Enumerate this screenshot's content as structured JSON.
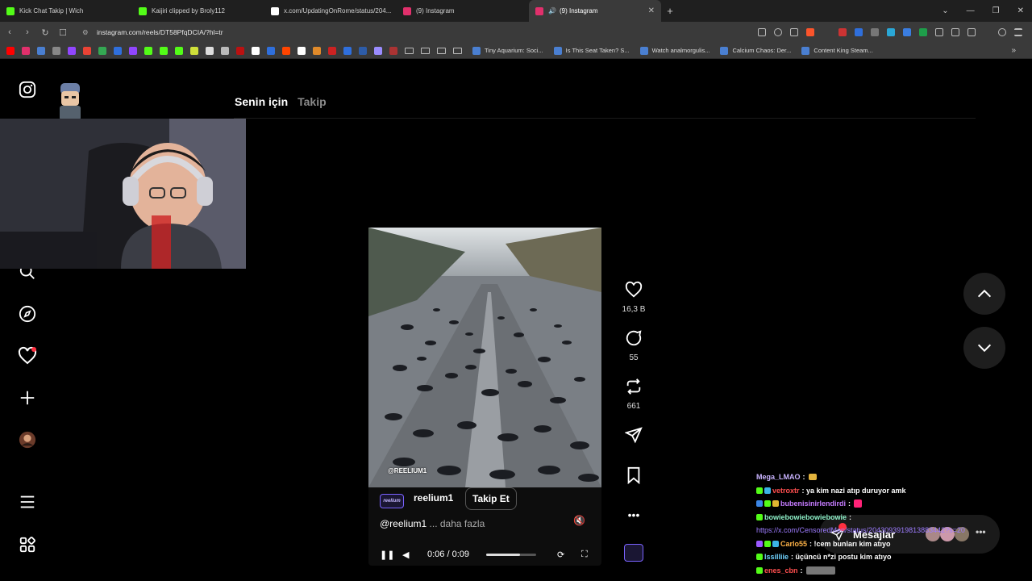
{
  "browser": {
    "tabs": [
      {
        "title": "Kick Chat Takip | Wich",
        "color": "#53fc18"
      },
      {
        "title": "Kaijiri clipped by Broly112",
        "color": "#53fc18"
      },
      {
        "title": "x.com/UpdatingOnRome/status/204...",
        "color": "#ffffff"
      },
      {
        "title": "(9) Instagram",
        "color": "#e1306c"
      },
      {
        "title": "(9) Instagram",
        "color": "#e1306c",
        "active": true
      }
    ],
    "url": "instagram.com/reels/DT58PfqDCIA/?hl=tr",
    "bookmarks": [
      {
        "title": "Tiny Aquarium: Soci..."
      },
      {
        "title": "Is This Seat Taken? S..."
      },
      {
        "title": "Watch analmorgulis..."
      },
      {
        "title": "Calcium Chaos: Der..."
      },
      {
        "title": "Content King Steam..."
      }
    ]
  },
  "feed": {
    "tab_for_you": "Senin için",
    "tab_following": "Takip"
  },
  "reel": {
    "watermark": "@REELIUM1",
    "author": "reelium1",
    "author_logo": "reelium",
    "follow_label": "Takip Et",
    "caption_user": "@reelium1",
    "caption_more": "... daha fazla",
    "time": "0:06 / 0:09",
    "progress": 0.67
  },
  "actions": {
    "likes": "16,3 B",
    "comments": "55",
    "reposts": "661"
  },
  "chat": [
    {
      "user": "Mega_LMAO",
      "user_color": "#c9b3ff",
      "msg": ":",
      "emote": true
    },
    {
      "user": "vetroxtr",
      "user_color": "#ff4f4f",
      "msg": ": ya kim nazi atıp duruyor amk"
    },
    {
      "user": "bubenisinirlendirdi",
      "user_color": "#c57bff",
      "msg": ":",
      "emote": true
    },
    {
      "user": "bowiebowiebowiebowie",
      "user_color": "#8ef0c8",
      "msg": ":"
    },
    {
      "user": "",
      "user_color": "#9d7cff",
      "msg": "https://x.com/CensoredMen/status/2043093919813883442?s=20",
      "link": true
    },
    {
      "user": "Carlo55",
      "user_color": "#ffb347",
      "msg": ": !cem bunları kim atıyo"
    },
    {
      "user": "lssilliie",
      "user_color": "#6fd3ff",
      "msg": ": üçüncü n*zi postu kim atıyo"
    },
    {
      "user": "enes_cbn",
      "user_color": "#ff4f4f",
      "msg": ":",
      "emote": true
    }
  ],
  "messages_label": "Mesajlar"
}
